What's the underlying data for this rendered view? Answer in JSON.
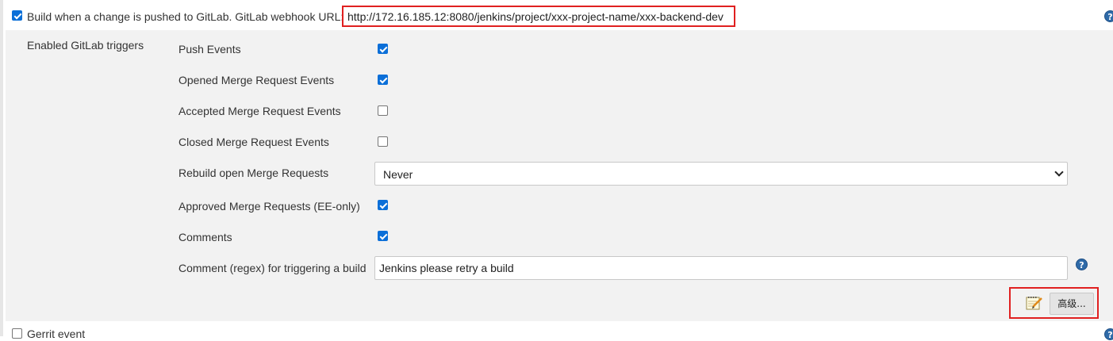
{
  "trigger": {
    "checked": true,
    "label": "Build when a change is pushed to GitLab. GitLab webhook URL:",
    "webhook_url": "http://172.16.185.12:8080/jenkins/project/xxx-project-name/xxx-backend-dev"
  },
  "section": {
    "title": "Enabled GitLab triggers",
    "rows": [
      {
        "label": "Push Events",
        "checked": true
      },
      {
        "label": "Opened Merge Request Events",
        "checked": true
      },
      {
        "label": "Accepted Merge Request Events",
        "checked": false
      },
      {
        "label": "Closed Merge Request Events",
        "checked": false
      },
      {
        "label": "Rebuild open Merge Requests",
        "value": "Never"
      },
      {
        "label": "Approved Merge Requests (EE-only)",
        "checked": true
      },
      {
        "label": "Comments",
        "checked": true
      },
      {
        "label": "Comment (regex) for triggering a build",
        "value": "Jenkins please retry a build"
      }
    ]
  },
  "advanced": {
    "label": "高级..."
  },
  "gerrit": {
    "label": "Gerrit event",
    "checked": false
  },
  "icons": {
    "help": "help-icon",
    "notepad": "notepad-icon",
    "dropdown": "chevron-down-icon"
  },
  "colors": {
    "accent": "#0b6fd8",
    "highlight": "#e02020",
    "panel": "#f2f2f2"
  }
}
